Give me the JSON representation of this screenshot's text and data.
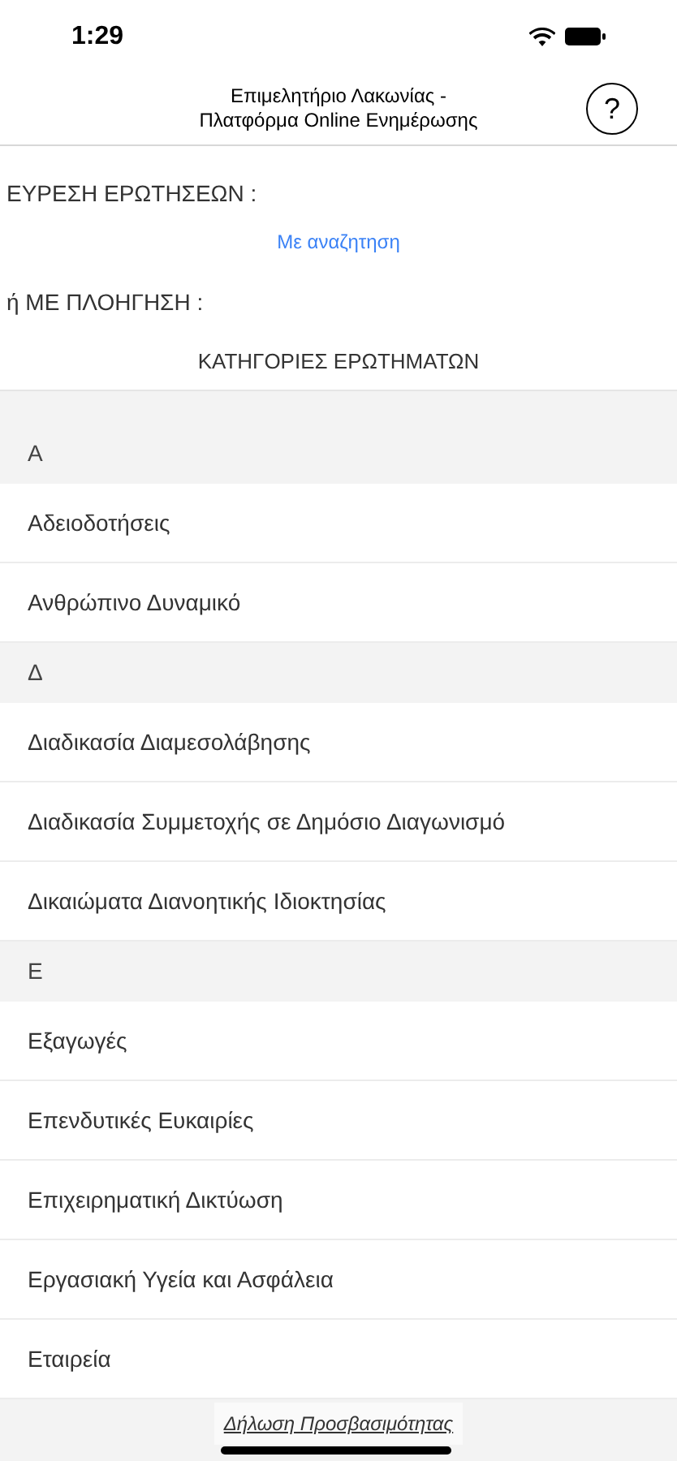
{
  "status_bar": {
    "time": "1:29"
  },
  "header": {
    "title": "Επιμελητήριο Λακωνίας -\nΠλατφόρμα Online Ενημέρωσης",
    "help": "?"
  },
  "search_label": "ΕΥΡΕΣΗ ΕΡΩΤΗΣΕΩΝ :",
  "search_link": "Με αναζητηση",
  "browse_label": "ή ΜΕ ΠΛΟΗΓΗΣΗ :",
  "categories_title": "ΚΑΤΗΓΟΡΙΕΣ ΕΡΩΤΗΜΑΤΩΝ",
  "sections": [
    {
      "letter": "Α",
      "items": [
        "Αδειοδοτήσεις",
        "Ανθρώπινο Δυναμικό"
      ]
    },
    {
      "letter": "Δ",
      "items": [
        "Διαδικασία Διαμεσολάβησης",
        "Διαδικασία Συμμετοχής σε Δημόσιο Διαγωνισμό",
        "Δικαιώματα Διανοητικής Ιδιοκτησίας"
      ]
    },
    {
      "letter": "Ε",
      "items": [
        "Εξαγωγές",
        "Επενδυτικές Ευκαιρίες",
        "Επιχειρηματική Δικτύωση",
        "Εργασιακή Υγεία και Ασφάλεια",
        "Εταιρεία"
      ]
    }
  ],
  "footer_link": "Δήλωση Προσβασιμότητας"
}
